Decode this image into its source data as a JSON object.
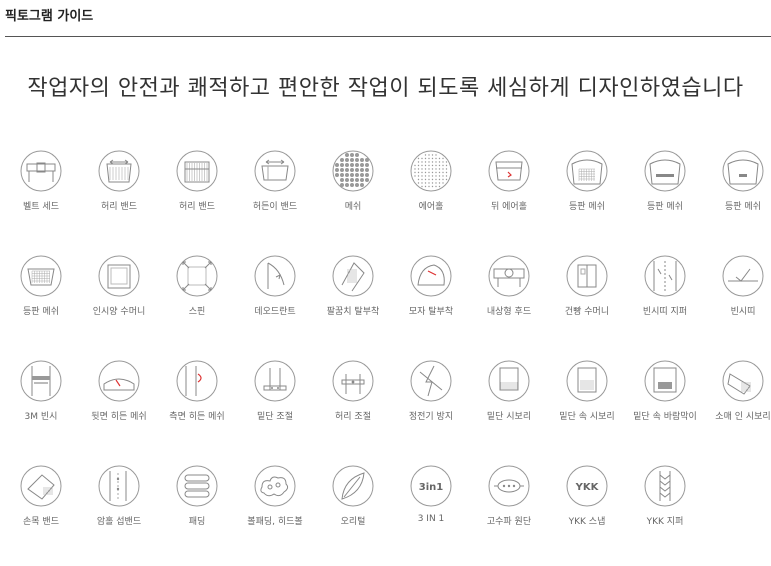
{
  "header": {
    "title": "픽토그램 가이드"
  },
  "subtitle": "작업자의 안전과 쾌적하고 편안한 작업이 되도록 세심하게 디자인하였습니다",
  "items": [
    {
      "label": "벨트 세드",
      "icon": "belt-icon"
    },
    {
      "label": "허리 밴드",
      "icon": "waist-band-icon"
    },
    {
      "label": "허리 밴드",
      "icon": "waist-band-ribbed-icon"
    },
    {
      "label": "허든이 밴드",
      "icon": "hip-band-icon"
    },
    {
      "label": "메쉬",
      "icon": "mesh-icon"
    },
    {
      "label": "에어홀",
      "icon": "air-hole-icon"
    },
    {
      "label": "뒤 에어홀",
      "icon": "back-air-hole-icon"
    },
    {
      "label": "등판 메쉬",
      "icon": "back-mesh-icon"
    },
    {
      "label": "등판 메쉬",
      "icon": "back-mesh-band-icon"
    },
    {
      "label": "등판 메쉬",
      "icon": "back-mesh-tab-icon"
    },
    {
      "label": "등판 메쉬",
      "icon": "back-mesh-pocket-icon"
    },
    {
      "label": "인시양 수머니",
      "icon": "stretch-pocket-icon"
    },
    {
      "label": "스핀",
      "icon": "stretch-arrows-icon"
    },
    {
      "label": "데오드란트",
      "icon": "deodorant-icon"
    },
    {
      "label": "팔꿈치 탈부착",
      "icon": "elbow-detach-icon"
    },
    {
      "label": "모자 탈부착",
      "icon": "hood-detach-icon"
    },
    {
      "label": "내상형 후드",
      "icon": "inner-hood-icon"
    },
    {
      "label": "건빵 수머니",
      "icon": "cargo-pocket-icon"
    },
    {
      "label": "빈시띠 지퍼",
      "icon": "reflective-zipper-icon"
    },
    {
      "label": "빈시띠",
      "icon": "reflective-tape-icon"
    },
    {
      "label": "3M 빈시",
      "icon": "3m-reflective-icon"
    },
    {
      "label": "뒷면 히든 메쉬",
      "icon": "back-hidden-mesh-icon"
    },
    {
      "label": "측면 히든 메쉬",
      "icon": "side-hidden-mesh-icon"
    },
    {
      "label": "밑단 조절",
      "icon": "hem-adjust-icon"
    },
    {
      "label": "허리 조절",
      "icon": "waist-adjust-icon"
    },
    {
      "label": "정전기 방지",
      "icon": "anti-static-icon"
    },
    {
      "label": "밑단 시보리",
      "icon": "hem-rib-icon"
    },
    {
      "label": "밑단 속 시보리",
      "icon": "inner-hem-rib-icon"
    },
    {
      "label": "밑단 속 바람막이",
      "icon": "inner-windbreak-icon"
    },
    {
      "label": "소매 인 시보리",
      "icon": "sleeve-rib-icon"
    },
    {
      "label": "손목 밴드",
      "icon": "wrist-band-icon"
    },
    {
      "label": "암홀 섭밴드",
      "icon": "armhole-band-icon"
    },
    {
      "label": "패딩",
      "icon": "padding-icon"
    },
    {
      "label": "볼패딩, 히드볼",
      "icon": "ball-padding-icon"
    },
    {
      "label": "오리털",
      "icon": "down-feather-icon"
    },
    {
      "label": "3 IN 1",
      "icon": "3in1-icon",
      "badge": "3in1"
    },
    {
      "label": "고수파 원단",
      "icon": "high-fabric-icon"
    },
    {
      "label": "YKK 스냅",
      "icon": "ykk-snap-icon",
      "badge": "YKK"
    },
    {
      "label": "YKK 지퍼",
      "icon": "ykk-zipper-icon"
    }
  ]
}
